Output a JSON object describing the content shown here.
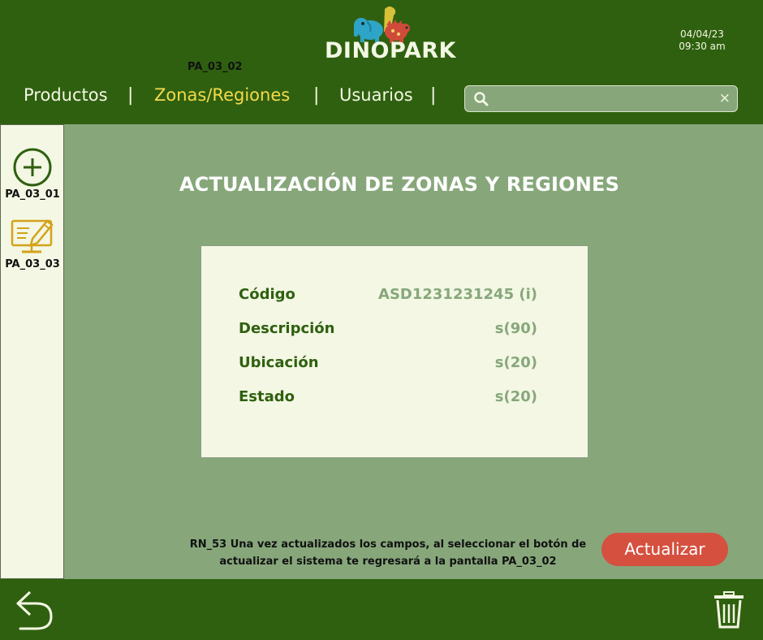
{
  "header": {
    "screen_code": "PA_03_02",
    "logo_text": "DINOPARK",
    "date": "04/04/23",
    "time": "09:30 am"
  },
  "nav": {
    "items": [
      {
        "label": "Productos",
        "active": false
      },
      {
        "label": "Zonas/Regiones",
        "active": true
      },
      {
        "label": "Usuarios",
        "active": false
      }
    ],
    "separator": "|"
  },
  "search": {
    "placeholder": "",
    "value": "",
    "clear_label": "×"
  },
  "sidebar": {
    "items": [
      {
        "icon": "add-circle-icon",
        "label": "PA_03_01"
      },
      {
        "icon": "edit-monitor-icon",
        "label": "PA_03_03"
      }
    ]
  },
  "main": {
    "title": "ACTUALIZACIÓN DE ZONAS Y REGIONES",
    "fields": [
      {
        "label": "Código",
        "value": "ASD1231231245 (i)"
      },
      {
        "label": "Descripción",
        "value": "s(90)"
      },
      {
        "label": "Ubicación",
        "value": "s(20)"
      },
      {
        "label": "Estado",
        "value": "s(20)"
      }
    ],
    "rule_line1": "RN_53 Una vez actualizados los campos, al seleccionar el botón de",
    "rule_line2": "actualizar el sistema te regresará a la pantalla PA_03_02",
    "update_button": "Actualizar"
  },
  "footer": {
    "back_icon": "back-arrow-icon",
    "trash_icon": "trash-icon"
  },
  "colors": {
    "header_bg": "#2f600f",
    "main_bg": "#87a77b",
    "panel_bg": "#f3f7e4",
    "active_nav": "#f4da4a",
    "button": "#d5503f"
  }
}
